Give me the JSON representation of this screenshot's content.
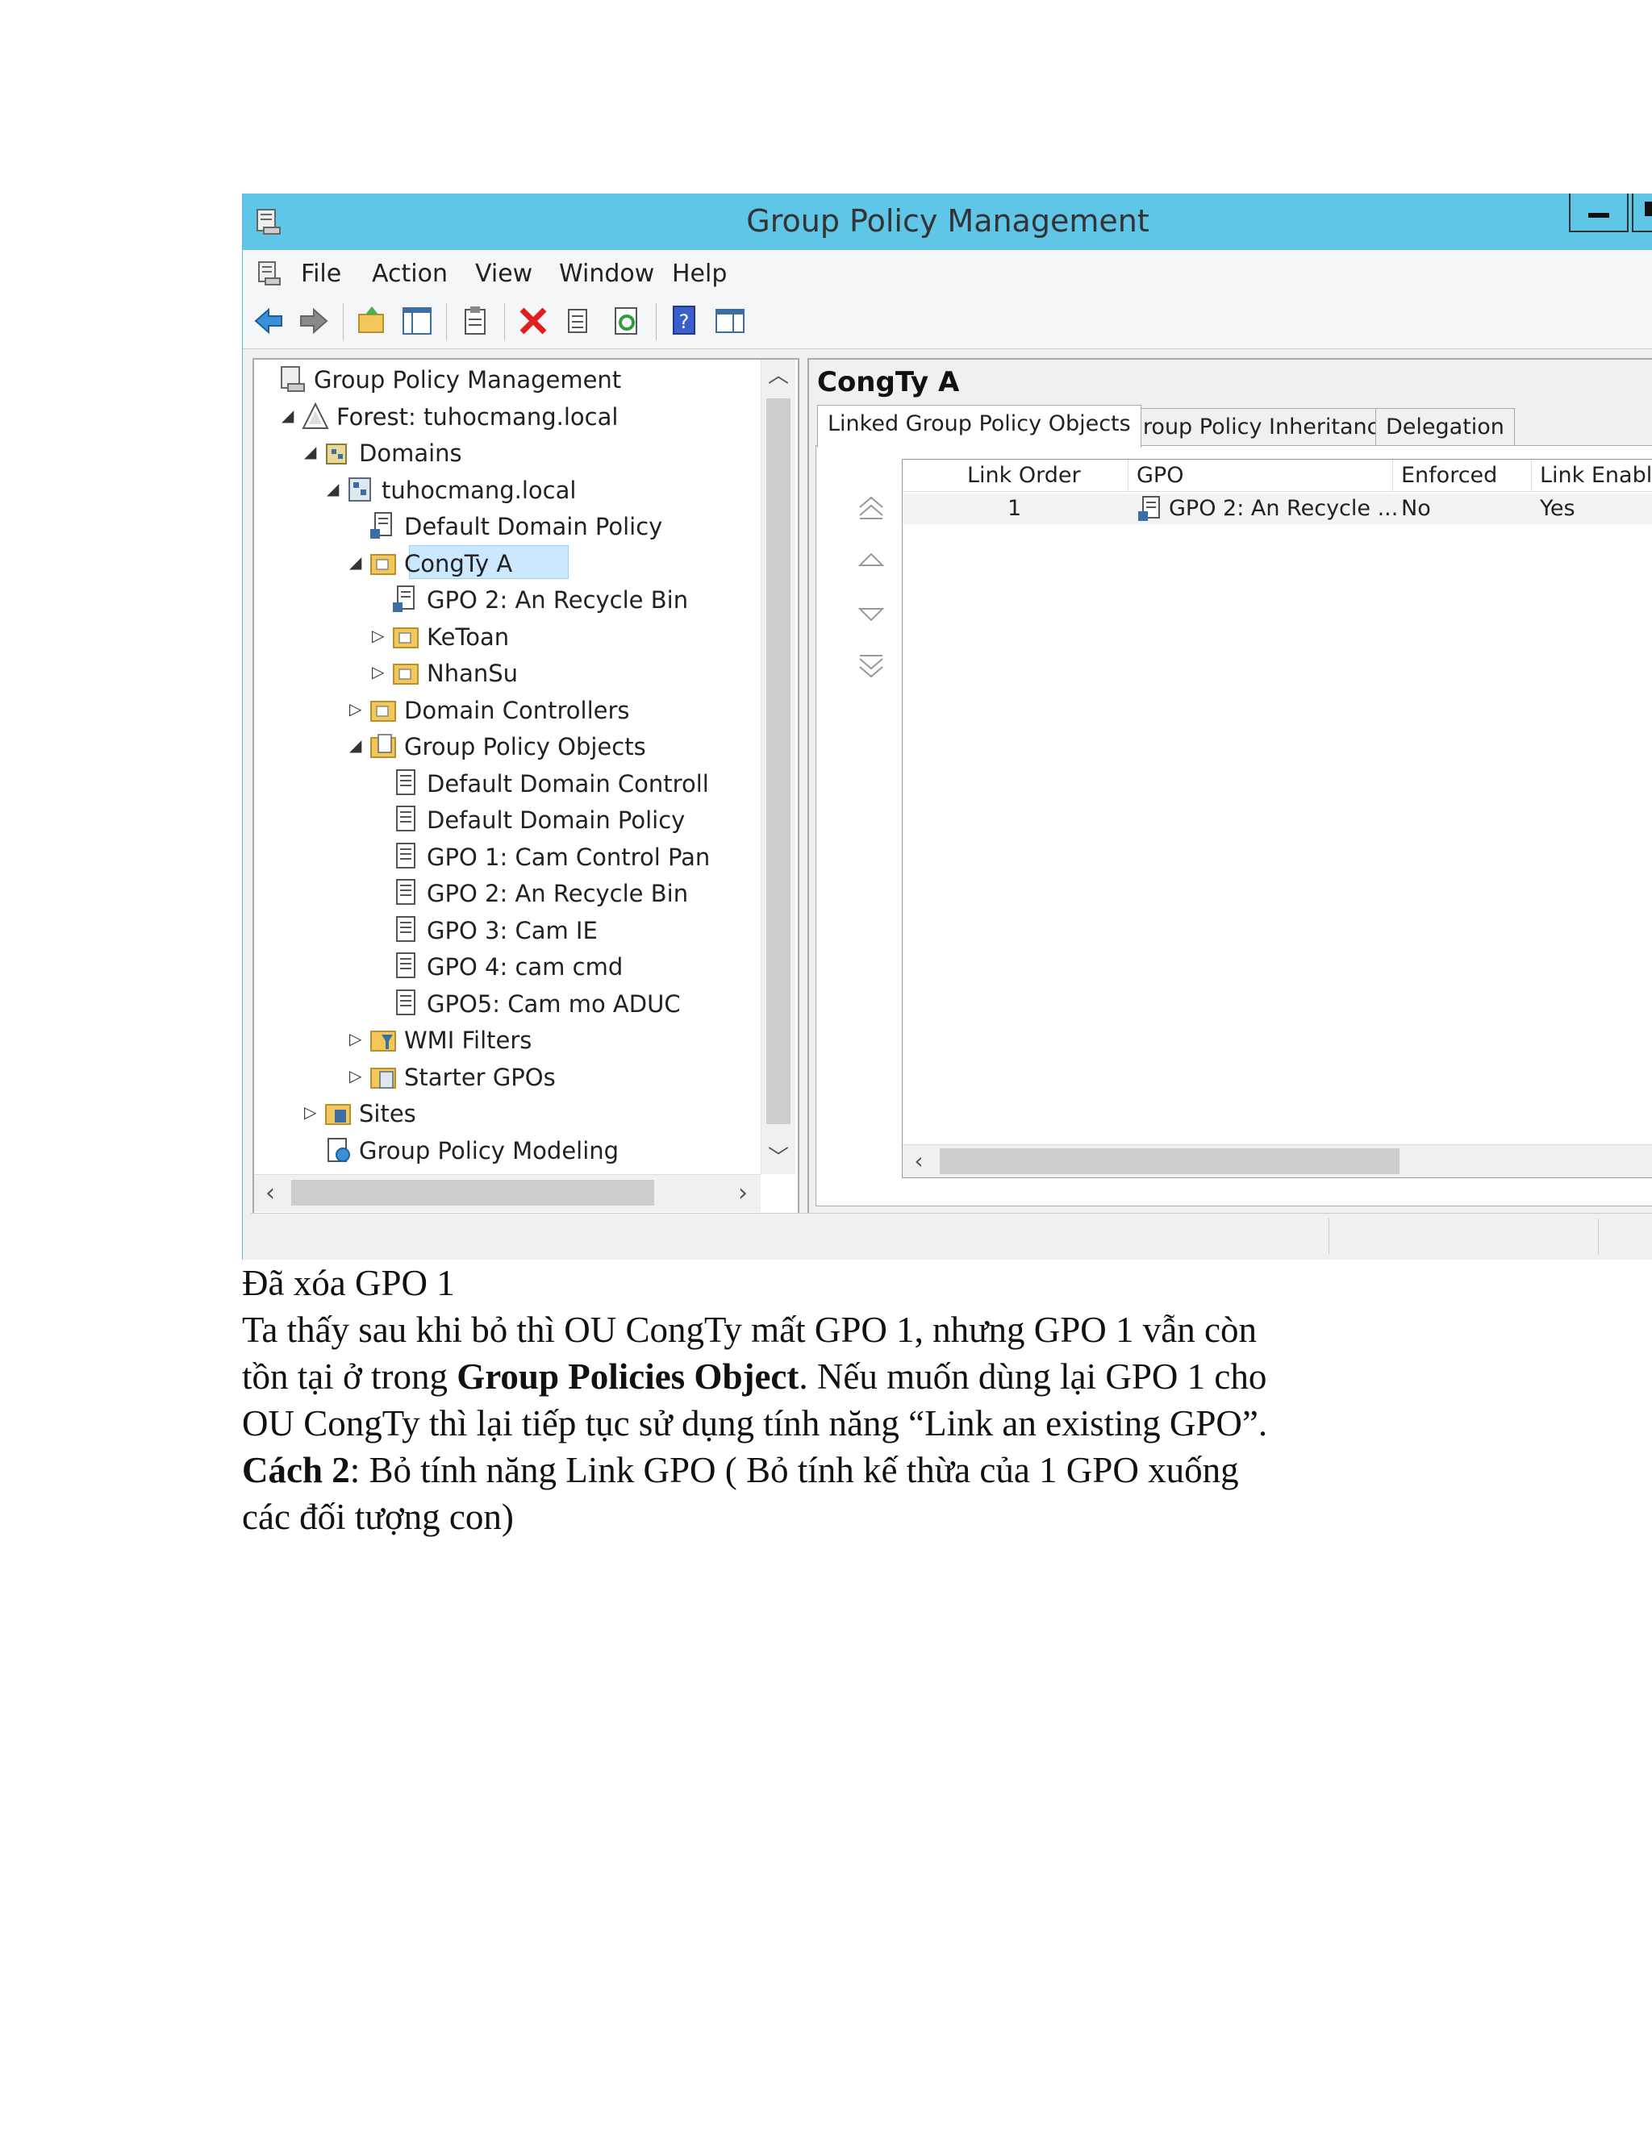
{
  "window": {
    "title": "Group Policy Management",
    "menu": [
      "File",
      "Action",
      "View",
      "Window",
      "Help"
    ]
  },
  "tree": {
    "nodes": [
      {
        "label": "Group Policy Management",
        "icon": "gpm-console-icon"
      },
      {
        "label": "Forest: tuhocmang.local",
        "icon": "forest-icon"
      },
      {
        "label": "Domains",
        "icon": "domains-icon"
      },
      {
        "label": "tuhocmang.local",
        "icon": "domain-icon"
      },
      {
        "label": "Default Domain Policy",
        "icon": "gpo-link-icon"
      },
      {
        "label": "CongTy A",
        "icon": "ou-folder-icon"
      },
      {
        "label": "GPO 2: An Recycle Bin",
        "icon": "gpo-link-icon"
      },
      {
        "label": "KeToan",
        "icon": "ou-folder-icon"
      },
      {
        "label": "NhanSu",
        "icon": "ou-folder-icon"
      },
      {
        "label": "Domain Controllers",
        "icon": "ou-folder-icon"
      },
      {
        "label": "Group Policy Objects",
        "icon": "gpo-container-icon"
      },
      {
        "label": "Default Domain Controll",
        "icon": "gpo-icon"
      },
      {
        "label": "Default Domain Policy",
        "icon": "gpo-icon"
      },
      {
        "label": "GPO 1: Cam Control Pan",
        "icon": "gpo-icon"
      },
      {
        "label": "GPO 2: An Recycle Bin",
        "icon": "gpo-icon"
      },
      {
        "label": "GPO 3: Cam IE",
        "icon": "gpo-icon"
      },
      {
        "label": "GPO 4: cam cmd",
        "icon": "gpo-icon"
      },
      {
        "label": "GPO5: Cam mo ADUC",
        "icon": "gpo-icon"
      },
      {
        "label": "WMI Filters",
        "icon": "wmi-filters-icon"
      },
      {
        "label": "Starter GPOs",
        "icon": "starter-gpos-icon"
      },
      {
        "label": "Sites",
        "icon": "sites-icon"
      },
      {
        "label": "Group Policy Modeling",
        "icon": "modeling-icon"
      }
    ]
  },
  "right_pane": {
    "heading": "CongTy A",
    "tabs": [
      "Linked Group Policy Objects",
      "Group Policy Inheritance",
      "Delegation"
    ],
    "columns": [
      "Link Order",
      "GPO",
      "Enforced",
      "Link Enabled"
    ],
    "rows": [
      {
        "link_order": "1",
        "gpo": "GPO 2: An Recycle ...",
        "enforced": "No",
        "link_enabled": "Yes"
      }
    ]
  },
  "document": {
    "line1": "Đã xóa GPO 1",
    "line2": "Ta thấy sau khi bỏ thì OU CongTy mất GPO 1, nhưng GPO 1 vẫn còn",
    "line3_a": "tồn tại ở trong ",
    "line3_bold": "Group Policies Object",
    "line3_b": ". Nếu muốn dùng lại GPO 1 cho",
    "line4": "OU CongTy thì lại tiếp tục sử dụng tính năng  “Link an existing GPO”.",
    "line5_bold": "Cách 2",
    "line5_rest": ": Bỏ tính năng Link GPO ( Bỏ tính kế thừa của 1 GPO xuống",
    "line6": "các đối tượng con)"
  },
  "colors": {
    "titlebar": "#60c6e8",
    "selection": "#cce8ff",
    "delete_red": "#e02020"
  }
}
